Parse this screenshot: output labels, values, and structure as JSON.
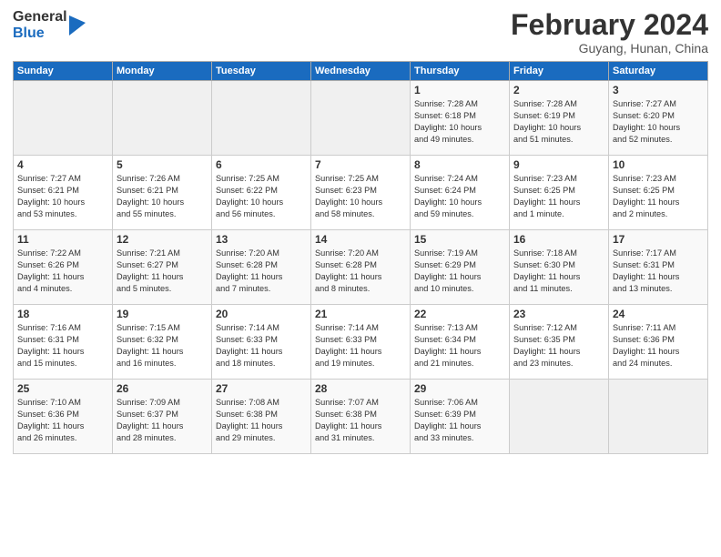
{
  "logo": {
    "general": "General",
    "blue": "Blue"
  },
  "title": "February 2024",
  "location": "Guyang, Hunan, China",
  "days_of_week": [
    "Sunday",
    "Monday",
    "Tuesday",
    "Wednesday",
    "Thursday",
    "Friday",
    "Saturday"
  ],
  "weeks": [
    [
      {
        "day": "",
        "info": ""
      },
      {
        "day": "",
        "info": ""
      },
      {
        "day": "",
        "info": ""
      },
      {
        "day": "",
        "info": ""
      },
      {
        "day": "1",
        "info": "Sunrise: 7:28 AM\nSunset: 6:18 PM\nDaylight: 10 hours\nand 49 minutes."
      },
      {
        "day": "2",
        "info": "Sunrise: 7:28 AM\nSunset: 6:19 PM\nDaylight: 10 hours\nand 51 minutes."
      },
      {
        "day": "3",
        "info": "Sunrise: 7:27 AM\nSunset: 6:20 PM\nDaylight: 10 hours\nand 52 minutes."
      }
    ],
    [
      {
        "day": "4",
        "info": "Sunrise: 7:27 AM\nSunset: 6:21 PM\nDaylight: 10 hours\nand 53 minutes."
      },
      {
        "day": "5",
        "info": "Sunrise: 7:26 AM\nSunset: 6:21 PM\nDaylight: 10 hours\nand 55 minutes."
      },
      {
        "day": "6",
        "info": "Sunrise: 7:25 AM\nSunset: 6:22 PM\nDaylight: 10 hours\nand 56 minutes."
      },
      {
        "day": "7",
        "info": "Sunrise: 7:25 AM\nSunset: 6:23 PM\nDaylight: 10 hours\nand 58 minutes."
      },
      {
        "day": "8",
        "info": "Sunrise: 7:24 AM\nSunset: 6:24 PM\nDaylight: 10 hours\nand 59 minutes."
      },
      {
        "day": "9",
        "info": "Sunrise: 7:23 AM\nSunset: 6:25 PM\nDaylight: 11 hours\nand 1 minute."
      },
      {
        "day": "10",
        "info": "Sunrise: 7:23 AM\nSunset: 6:25 PM\nDaylight: 11 hours\nand 2 minutes."
      }
    ],
    [
      {
        "day": "11",
        "info": "Sunrise: 7:22 AM\nSunset: 6:26 PM\nDaylight: 11 hours\nand 4 minutes."
      },
      {
        "day": "12",
        "info": "Sunrise: 7:21 AM\nSunset: 6:27 PM\nDaylight: 11 hours\nand 5 minutes."
      },
      {
        "day": "13",
        "info": "Sunrise: 7:20 AM\nSunset: 6:28 PM\nDaylight: 11 hours\nand 7 minutes."
      },
      {
        "day": "14",
        "info": "Sunrise: 7:20 AM\nSunset: 6:28 PM\nDaylight: 11 hours\nand 8 minutes."
      },
      {
        "day": "15",
        "info": "Sunrise: 7:19 AM\nSunset: 6:29 PM\nDaylight: 11 hours\nand 10 minutes."
      },
      {
        "day": "16",
        "info": "Sunrise: 7:18 AM\nSunset: 6:30 PM\nDaylight: 11 hours\nand 11 minutes."
      },
      {
        "day": "17",
        "info": "Sunrise: 7:17 AM\nSunset: 6:31 PM\nDaylight: 11 hours\nand 13 minutes."
      }
    ],
    [
      {
        "day": "18",
        "info": "Sunrise: 7:16 AM\nSunset: 6:31 PM\nDaylight: 11 hours\nand 15 minutes."
      },
      {
        "day": "19",
        "info": "Sunrise: 7:15 AM\nSunset: 6:32 PM\nDaylight: 11 hours\nand 16 minutes."
      },
      {
        "day": "20",
        "info": "Sunrise: 7:14 AM\nSunset: 6:33 PM\nDaylight: 11 hours\nand 18 minutes."
      },
      {
        "day": "21",
        "info": "Sunrise: 7:14 AM\nSunset: 6:33 PM\nDaylight: 11 hours\nand 19 minutes."
      },
      {
        "day": "22",
        "info": "Sunrise: 7:13 AM\nSunset: 6:34 PM\nDaylight: 11 hours\nand 21 minutes."
      },
      {
        "day": "23",
        "info": "Sunrise: 7:12 AM\nSunset: 6:35 PM\nDaylight: 11 hours\nand 23 minutes."
      },
      {
        "day": "24",
        "info": "Sunrise: 7:11 AM\nSunset: 6:36 PM\nDaylight: 11 hours\nand 24 minutes."
      }
    ],
    [
      {
        "day": "25",
        "info": "Sunrise: 7:10 AM\nSunset: 6:36 PM\nDaylight: 11 hours\nand 26 minutes."
      },
      {
        "day": "26",
        "info": "Sunrise: 7:09 AM\nSunset: 6:37 PM\nDaylight: 11 hours\nand 28 minutes."
      },
      {
        "day": "27",
        "info": "Sunrise: 7:08 AM\nSunset: 6:38 PM\nDaylight: 11 hours\nand 29 minutes."
      },
      {
        "day": "28",
        "info": "Sunrise: 7:07 AM\nSunset: 6:38 PM\nDaylight: 11 hours\nand 31 minutes."
      },
      {
        "day": "29",
        "info": "Sunrise: 7:06 AM\nSunset: 6:39 PM\nDaylight: 11 hours\nand 33 minutes."
      },
      {
        "day": "",
        "info": ""
      },
      {
        "day": "",
        "info": ""
      }
    ]
  ]
}
